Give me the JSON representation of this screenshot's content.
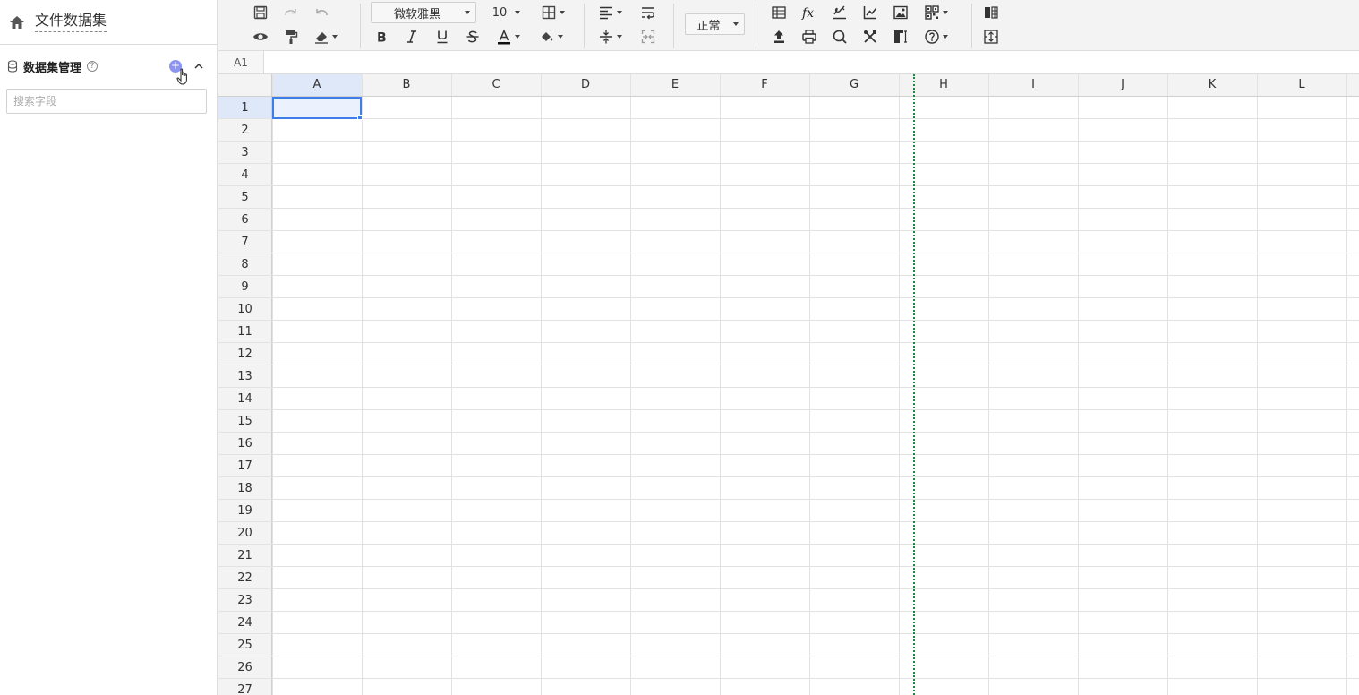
{
  "sidebar": {
    "title": "文件数据集",
    "dataset_label": "数据集管理",
    "help_glyph": "?",
    "add_glyph": "+",
    "search_placeholder": "搜索字段"
  },
  "toolbar": {
    "font_family": "微软雅黑",
    "font_size": "10",
    "display_mode": "正常"
  },
  "formula_bar": {
    "cell_ref": "A1"
  },
  "grid": {
    "columns": [
      "A",
      "B",
      "C",
      "D",
      "E",
      "F",
      "G",
      "H",
      "I",
      "J",
      "K",
      "L"
    ],
    "rows": [
      "1",
      "2",
      "3",
      "4",
      "5",
      "6",
      "7",
      "8",
      "9",
      "10",
      "11",
      "12",
      "13",
      "14",
      "15",
      "16",
      "17",
      "18",
      "19",
      "20",
      "21",
      "22",
      "23",
      "24",
      "25",
      "26",
      "27"
    ],
    "selected_cell": "A1"
  },
  "colors": {
    "accent": "#3f7ee8",
    "add_button": "#8c94f0",
    "page_break": "#1a8a3a",
    "header_bg": "#f3f3f3",
    "selected_header_bg": "#dfe8f8"
  },
  "icons": {
    "toolbar_row1": [
      "save-icon",
      "redo-icon",
      "undo-icon",
      "borders-icon",
      "align-left-icon",
      "wrap-text-icon",
      "table-icon",
      "function-icon",
      "sign-icon",
      "chart-icon",
      "image-icon",
      "qrcode-icon",
      "form-icon"
    ],
    "toolbar_row2": [
      "preview-icon",
      "format-painter-icon",
      "eraser-icon",
      "bold-icon",
      "italic-icon",
      "underline-icon",
      "strikethrough-icon",
      "font-color-icon",
      "fill-color-icon",
      "vertical-align-icon",
      "merge-cells-icon",
      "upload-icon",
      "print-icon",
      "search-icon",
      "tools-icon",
      "freeze-icon",
      "help-icon",
      "expand-icon"
    ]
  }
}
